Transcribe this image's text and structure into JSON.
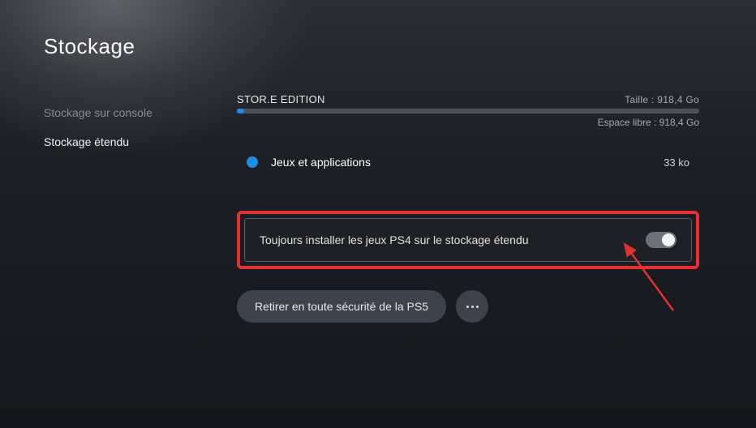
{
  "title": "Stockage",
  "sidebar": {
    "items": [
      {
        "label": "Stockage sur console",
        "active": false
      },
      {
        "label": "Stockage étendu",
        "active": true
      }
    ]
  },
  "storage": {
    "name": "STOR.E EDITION",
    "size_label": "Taille : 918,4 Go",
    "free_label": "Espace libre : 918,4 Go",
    "used_percent": 1.5
  },
  "category": {
    "label": "Jeux et applications",
    "size": "33 ko",
    "color": "#1e8de6"
  },
  "setting": {
    "label": "Toujours installer les jeux PS4 sur le stockage étendu",
    "enabled": true
  },
  "actions": {
    "remove": "Retirer en toute sécurité de la PS5"
  }
}
